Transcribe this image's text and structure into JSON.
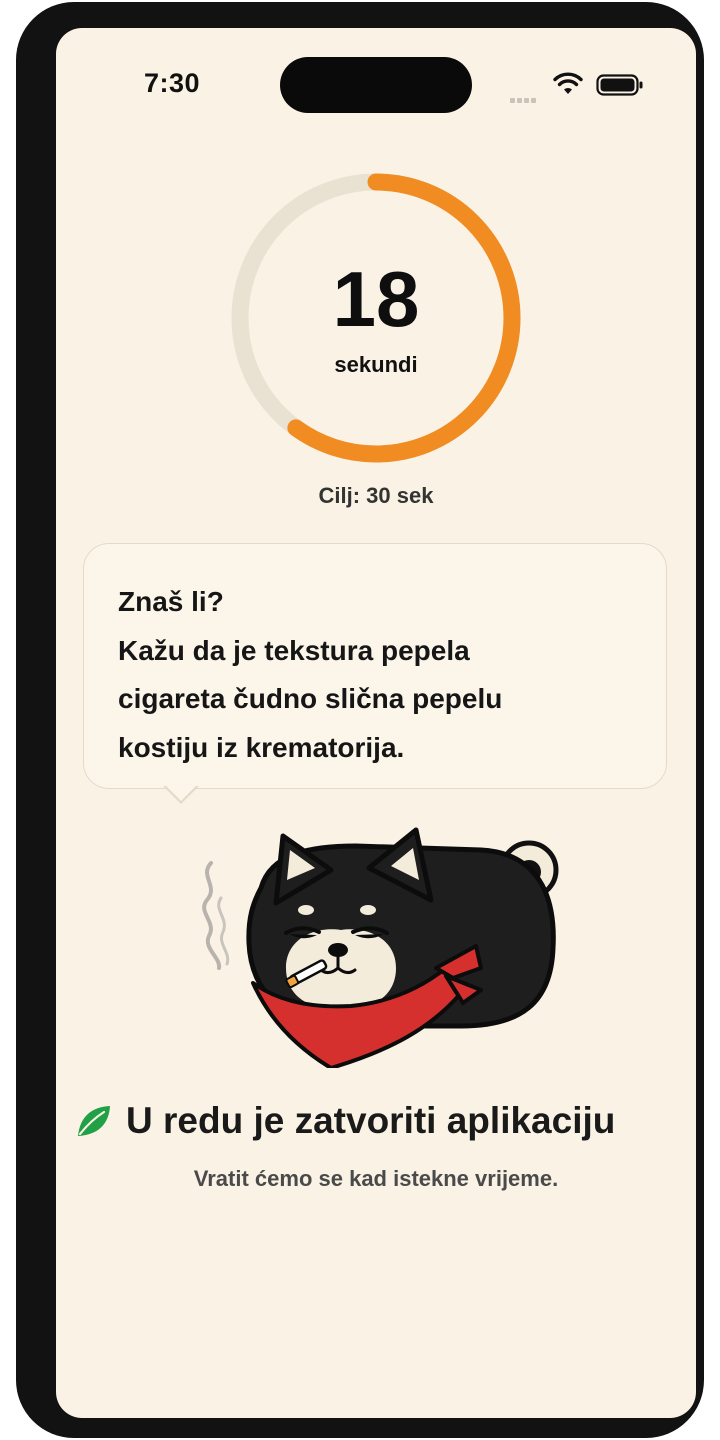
{
  "status_bar": {
    "time": "7:30"
  },
  "timer": {
    "value": "18",
    "unit": "sekundi",
    "goal_label": "Cilj: 30 sek",
    "progress_fraction": 0.6,
    "colors": {
      "progress": "#f08c22",
      "track": "#e9e1d1"
    }
  },
  "fact": {
    "lines": [
      "Znaš li?",
      "Kažu da je tekstura pepela",
      "cigareta čudno slična pepelu",
      "kostiju iz krematorija."
    ]
  },
  "mascot": {
    "icon": "smoking-shiba-dog-icon"
  },
  "footer": {
    "title": "U redu je zatvoriti aplikaciju",
    "subtitle": "Vratit ćemo se kad istekne vrijeme.",
    "icon": "leaf-icon",
    "leaf_color": "#22a046"
  }
}
